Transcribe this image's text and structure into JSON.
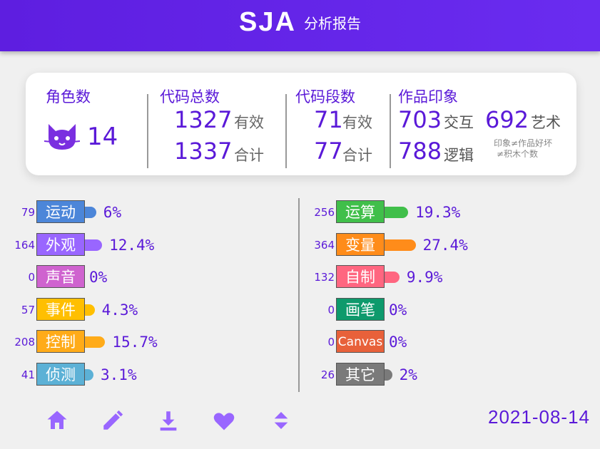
{
  "header": {
    "logo": "SJA",
    "subtitle": "分析报告"
  },
  "summary": {
    "roles": {
      "label": "角色数",
      "count": "14",
      "icon": "cat-icon"
    },
    "code_total": {
      "label": "代码总数",
      "valid_value": "1327",
      "valid_label": "有效",
      "total_value": "1337",
      "total_label": "合计"
    },
    "code_segments": {
      "label": "代码段数",
      "valid_value": "71",
      "valid_label": "有效",
      "total_value": "77",
      "total_label": "合计"
    },
    "impression": {
      "label": "作品印象",
      "interaction_value": "703",
      "interaction_label": "交互",
      "art_value": "692",
      "art_label": "艺术",
      "logic_value": "788",
      "logic_label": "逻辑",
      "note_line1": "印象≠作品好坏",
      "note_line2": "≠积木个数"
    }
  },
  "categories_left": [
    {
      "count": "79",
      "name": "运动",
      "pct": "6%",
      "value": 6.0,
      "color": "#4c86d9"
    },
    {
      "count": "164",
      "name": "外观",
      "pct": "12.4%",
      "value": 12.4,
      "color": "#9966ff"
    },
    {
      "count": "0",
      "name": "声音",
      "pct": "0%",
      "value": 0,
      "color": "#cf63cf"
    },
    {
      "count": "57",
      "name": "事件",
      "pct": "4.3%",
      "value": 4.3,
      "color": "#ffbf00"
    },
    {
      "count": "208",
      "name": "控制",
      "pct": "15.7%",
      "value": 15.7,
      "color": "#ffab19"
    },
    {
      "count": "41",
      "name": "侦测",
      "pct": "3.1%",
      "value": 3.1,
      "color": "#5cb1d6"
    }
  ],
  "categories_right": [
    {
      "count": "256",
      "name": "运算",
      "pct": "19.3%",
      "value": 19.3,
      "color": "#40bf4a"
    },
    {
      "count": "364",
      "name": "变量",
      "pct": "27.4%",
      "value": 27.4,
      "color": "#ff8c1a"
    },
    {
      "count": "132",
      "name": "自制",
      "pct": "9.9%",
      "value": 9.9,
      "color": "#ff6680"
    },
    {
      "count": "0",
      "name": "画笔",
      "pct": "0%",
      "value": 0,
      "color": "#0e9a6c"
    },
    {
      "count": "0",
      "name": "Canvas",
      "pct": "0%",
      "value": 0,
      "color": "#e8613a"
    },
    {
      "count": "26",
      "name": "其它",
      "pct": "2%",
      "value": 2.0,
      "color": "#7a7a7a"
    }
  ],
  "toolbar": {
    "buttons": [
      {
        "icon": "home-icon"
      },
      {
        "icon": "pencil-icon"
      },
      {
        "icon": "download-icon"
      },
      {
        "icon": "heart-icon"
      },
      {
        "icon": "sort-icon"
      }
    ],
    "accent": "#9966ff"
  },
  "footer": {
    "date": "2021-08-14"
  }
}
